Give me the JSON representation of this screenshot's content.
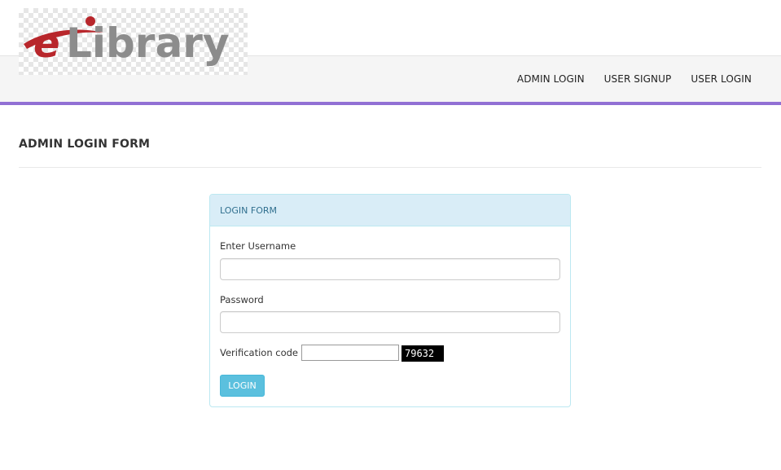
{
  "brand": {
    "logo_text": "eLibrary",
    "logo_colors": {
      "e": "#b8262b",
      "swoosh": "#b8262b",
      "library": "#8c8c8c"
    }
  },
  "nav": {
    "items": [
      {
        "label": "ADMIN LOGIN"
      },
      {
        "label": "USER SIGNUP"
      },
      {
        "label": "USER LOGIN"
      }
    ]
  },
  "page": {
    "title": "ADMIN LOGIN FORM"
  },
  "form": {
    "heading": "LOGIN FORM",
    "username_label": "Enter Username",
    "username_value": "",
    "password_label": "Password",
    "password_value": "",
    "verification_label": "Verification code :",
    "verification_value": "",
    "captcha_code": "79632",
    "submit_label": "LOGIN"
  },
  "colors": {
    "accent_bar": "#9170d4",
    "panel_heading_bg": "#d9edf7",
    "panel_heading_text": "#31708f",
    "button_bg": "#5bc0de"
  }
}
